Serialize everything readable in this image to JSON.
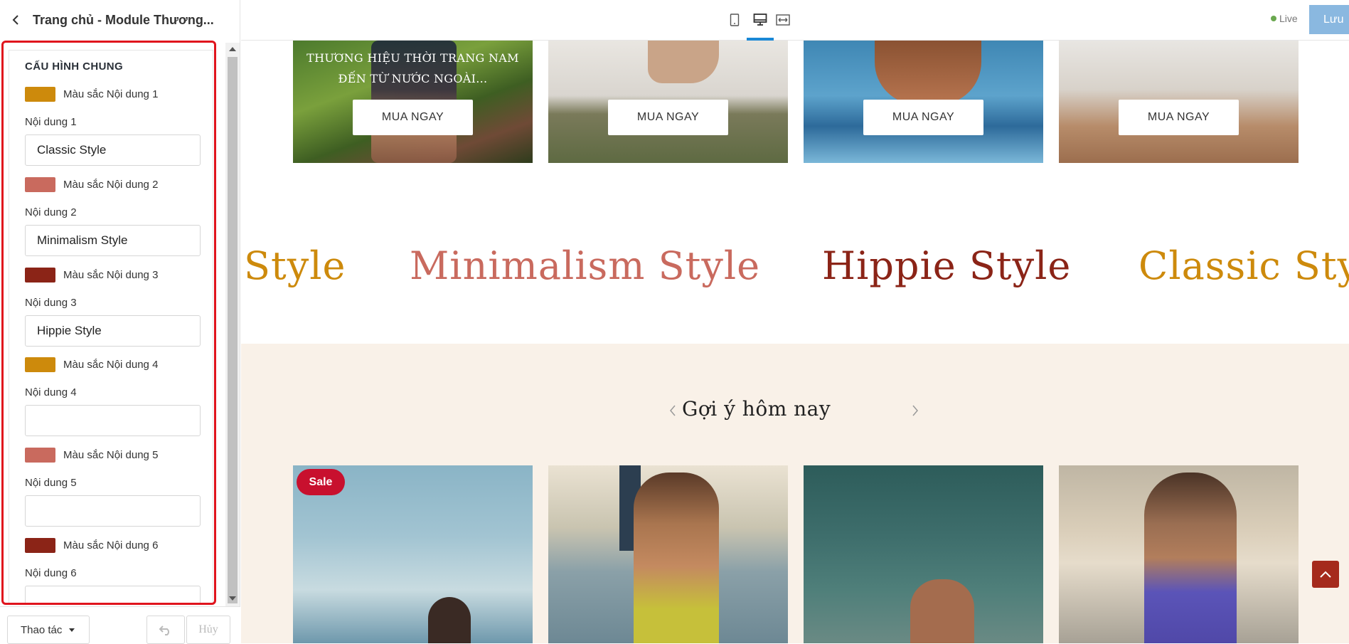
{
  "sidebar": {
    "title": "Trang chủ - Module Thương...",
    "section_heading": "CẤU HÌNH CHUNG",
    "fields": [
      {
        "swatch_label": "Màu sắc Nội dung 1",
        "swatch_color": "#cd8a0c",
        "label": "Nội dung 1",
        "value": "Classic Style"
      },
      {
        "swatch_label": "Màu sắc Nội dung 2",
        "swatch_color": "#c96a5e",
        "label": "Nội dung 2",
        "value": "Minimalism Style"
      },
      {
        "swatch_label": "Màu sắc Nội dung 3",
        "swatch_color": "#8b2417",
        "label": "Nội dung 3",
        "value": "Hippie Style"
      },
      {
        "swatch_label": "Màu sắc Nội dung 4",
        "swatch_color": "#cd8a0c",
        "label": "Nội dung 4",
        "value": ""
      },
      {
        "swatch_label": "Màu sắc Nội dung 5",
        "swatch_color": "#c96a5e",
        "label": "Nội dung 5",
        "value": ""
      },
      {
        "swatch_label": "Màu sắc Nội dung 6",
        "swatch_color": "#8b2417",
        "label": "Nội dung 6",
        "value": ""
      }
    ],
    "footer": {
      "actions_label": "Thao tác",
      "cancel_label": "Hủy"
    }
  },
  "topbar": {
    "device_icons": [
      "mobile-icon",
      "desktop-icon",
      "fullwidth-icon"
    ],
    "active_device": "desktop",
    "live_label": "Live",
    "save_label": "Lưu"
  },
  "preview": {
    "banners": [
      {
        "text_line1": "THƯƠNG HIỆU THỜI TRANG NAM",
        "text_line2": "ĐẾN TỪ NƯỚC NGOÀI...",
        "button": "MUA NGAY"
      },
      {
        "button": "MUA NGAY"
      },
      {
        "button": "MUA NGAY"
      },
      {
        "button": "MUA NGAY"
      }
    ],
    "marquee": [
      {
        "text": "Style",
        "color": "#cd8a0c"
      },
      {
        "text": "Minimalism Style",
        "color": "#c96a5e"
      },
      {
        "text": "Hippie Style",
        "color": "#8b2417"
      },
      {
        "text": "Classic Style",
        "color": "#cd8a0c"
      }
    ],
    "suggest_title": "Gợi ý hôm nay",
    "sale_badge": "Sale",
    "accent_color": "#a52a1c"
  }
}
